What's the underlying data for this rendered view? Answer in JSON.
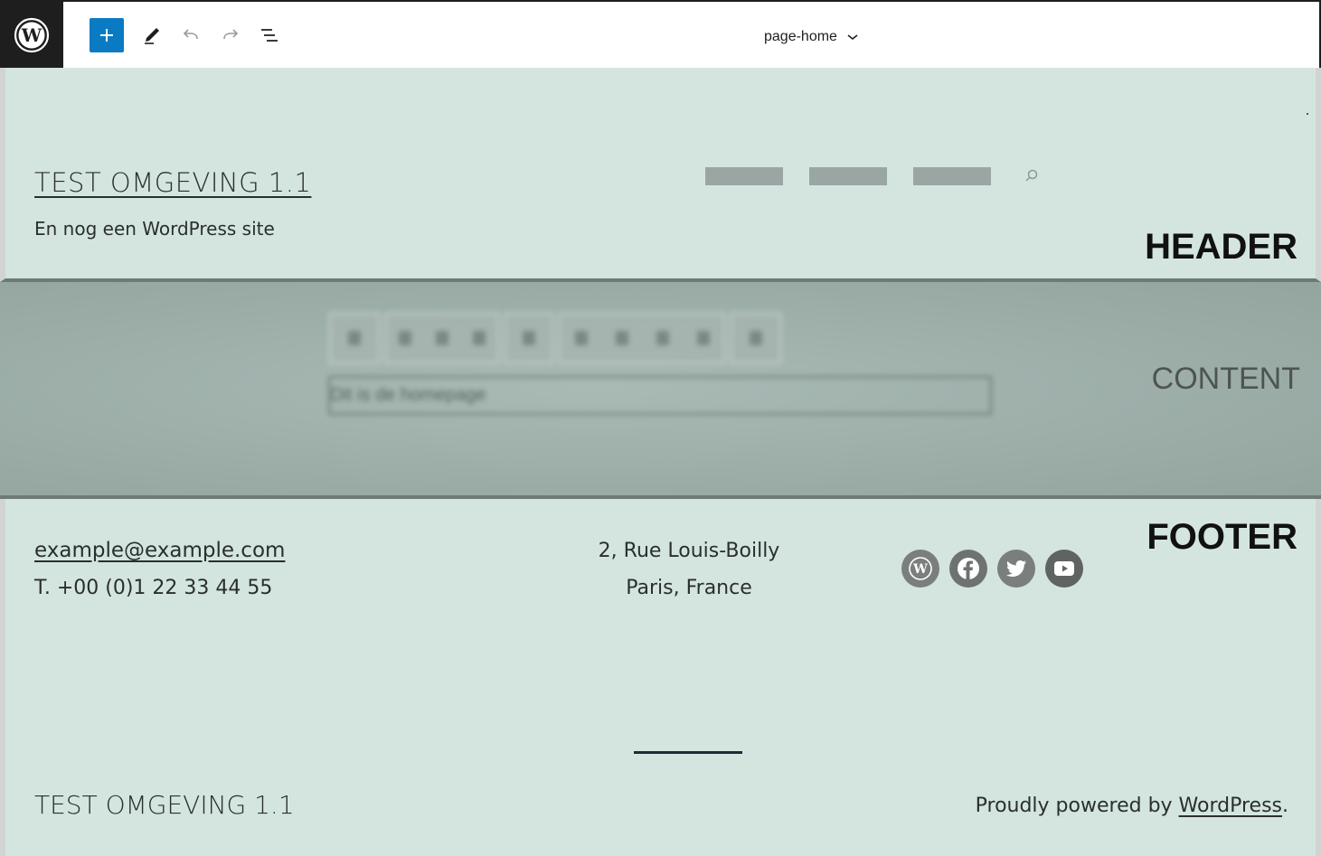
{
  "toolbar": {
    "add_label": "+",
    "document_title": "page-home"
  },
  "header": {
    "site_title": "TEST OMGEVING 1.1",
    "tagline": "En nog een WordPress site",
    "region_label": "HEADER",
    "nav_items": [
      "",
      "",
      ""
    ]
  },
  "content": {
    "paragraph_text": "Dit is de homepage",
    "region_label": "CONTENT"
  },
  "footer": {
    "email": "example@example.com",
    "phone": "T. +00 (0)1 22 33 44 55",
    "address_line1": "2, Rue Louis-Boilly",
    "address_line2": "Paris, France",
    "region_label": "FOOTER",
    "site_title": "TEST OMGEVING 1.1",
    "powered_prefix": "Proudly powered by ",
    "powered_link": "WordPress",
    "powered_suffix": ".",
    "socials": [
      {
        "icon": "wordpress-icon",
        "color": "#7a7f7d"
      },
      {
        "icon": "facebook-icon",
        "color": "#6e7371"
      },
      {
        "icon": "twitter-icon",
        "color": "#7a7f7d"
      },
      {
        "icon": "youtube-icon",
        "color": "#5f6462"
      }
    ]
  },
  "colors": {
    "accent": "#0a7bc2",
    "canvas": "#d4e5df",
    "content_overlay": "#9cada8",
    "dark": "#1e1e1e"
  }
}
